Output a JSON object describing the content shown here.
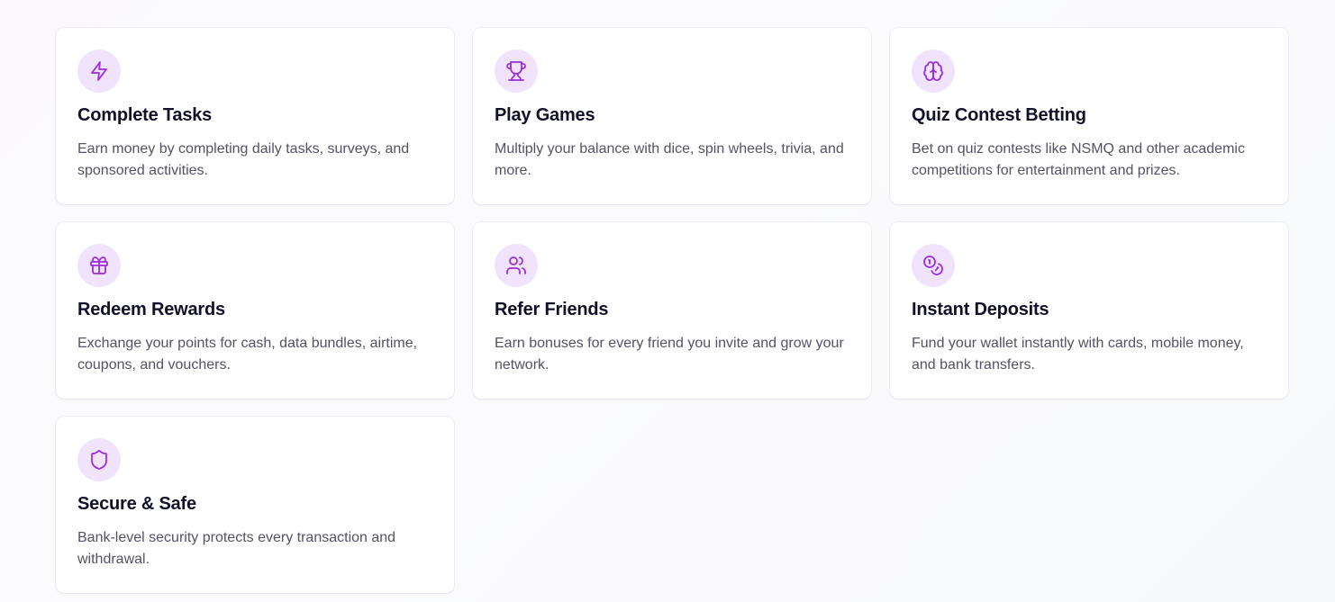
{
  "features": [
    {
      "icon": "lightning-icon",
      "title": "Complete Tasks",
      "description": "Earn money by completing daily tasks, surveys, and sponsored activities."
    },
    {
      "icon": "trophy-icon",
      "title": "Play Games",
      "description": "Multiply your balance with dice, spin wheels, trivia, and more."
    },
    {
      "icon": "brain-icon",
      "title": "Quiz Contest Betting",
      "description": "Bet on quiz contests like NSMQ and other academic competitions for entertainment and prizes."
    },
    {
      "icon": "gift-icon",
      "title": "Redeem Rewards",
      "description": "Exchange your points for cash, data bundles, airtime, coupons, and vouchers."
    },
    {
      "icon": "users-icon",
      "title": "Refer Friends",
      "description": "Earn bonuses for every friend you invite and grow your network."
    },
    {
      "icon": "coins-icon",
      "title": "Instant Deposits",
      "description": "Fund your wallet instantly with cards, mobile money, and bank transfers."
    },
    {
      "icon": "shield-icon",
      "title": "Secure & Safe",
      "description": "Bank-level security protects every transaction and withdrawal."
    }
  ],
  "colors": {
    "accent": "#9b2fd8",
    "icon_background": "#f0e3fb",
    "title": "#111128",
    "body_text": "#535363"
  }
}
